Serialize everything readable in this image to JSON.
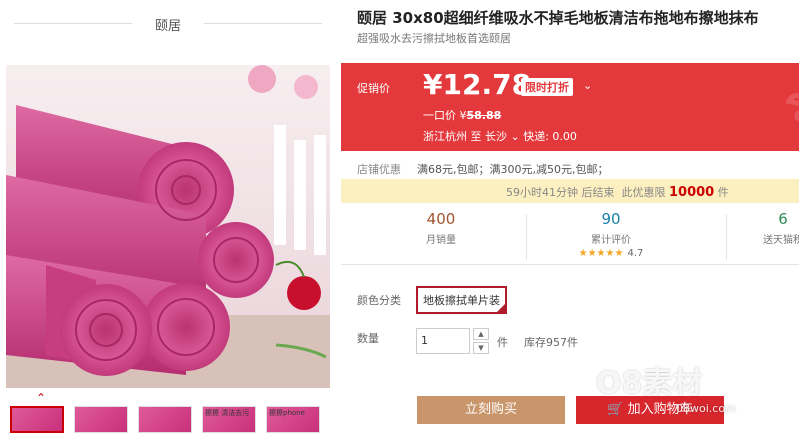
{
  "store": {
    "name": "颐居"
  },
  "product": {
    "title": "颐居 30x80超细纤维吸水不掉毛地板清洁布拖地布擦地抹布",
    "subtitle": "超强吸水去污擦拭地板首选颐居"
  },
  "price": {
    "promo_label": "促销价",
    "current": "¥12.78",
    "badge": "限时打折",
    "caret": "⌄",
    "original_prefix": "一口价 ¥",
    "original_value": "58.88",
    "ship_from": "浙江杭州",
    "to_word": "至",
    "ship_to": "长沙",
    "ship_to_caret": "⌄",
    "delivery": "快递: 0.00",
    "bg_deco": "ร"
  },
  "coupon": {
    "label": "店铺优惠",
    "text": "满68元,包邮；满300元,减50元,包邮；"
  },
  "countdown": {
    "time": "59小时41分钟 后结束",
    "price_text": "此优惠限",
    "qty": "10000",
    "unit": "件"
  },
  "stats": [
    {
      "num": "400",
      "label": "月销量"
    },
    {
      "num": "90",
      "label": "累计评价",
      "stars": "★★★★★",
      "rating": "4.7"
    },
    {
      "num": "6",
      "label": "送天猫积"
    }
  ],
  "sku": {
    "label": "颜色分类",
    "selected": "地板擦拭单片装"
  },
  "quantity": {
    "label": "数量",
    "value": "1",
    "unit": "件",
    "stock": "库存957件",
    "up": "▲",
    "down": "▼"
  },
  "actions": {
    "buy": "立刻购买",
    "cart": "加入购物车"
  },
  "gallery": {
    "up_arrow": "⌃",
    "thumb_texts": [
      "",
      "",
      "",
      "擦擦 清洁去污",
      "擦擦phone"
    ]
  },
  "watermark": {
    "big": "O8素材",
    "small": "08woi.com"
  },
  "colors": {
    "accent": "#e4393c",
    "buy": "#c9956b",
    "cart": "#d7262c",
    "pink": "#d94f8f"
  }
}
